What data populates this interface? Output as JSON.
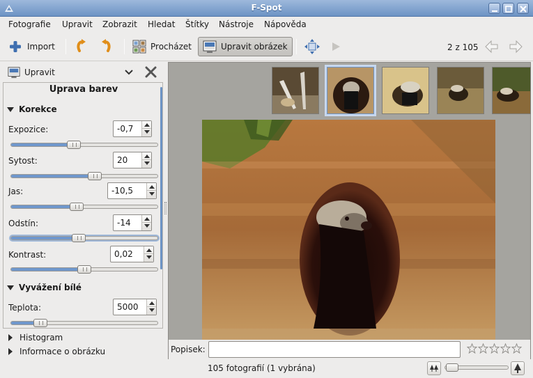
{
  "window": {
    "title": "F-Spot"
  },
  "menu": [
    "Fotografie",
    "Upravit",
    "Zobrazit",
    "Hledat",
    "Štítky",
    "Nástroje",
    "Nápověda"
  ],
  "toolbar": {
    "import_label": "Import",
    "browse_label": "Procházet",
    "edit_label": "Upravit obrázek",
    "position": "2 z 105"
  },
  "panel": {
    "selector_label": "Upravit",
    "section_title": "Uprava barev",
    "groups": {
      "correction": "Korekce",
      "white_balance": "Vyvážení bílé"
    },
    "controls": [
      {
        "label": "Expozice:",
        "value": "-0,7",
        "level": 0.42
      },
      {
        "label": "Sytost:",
        "value": "20",
        "level": 0.58
      },
      {
        "label": "Jas:",
        "value": "-10,5",
        "level": 0.44
      },
      {
        "label": "Odstín:",
        "value": "-14",
        "level": 0.46
      },
      {
        "label": "Kontrast:",
        "value": "0,02",
        "level": 0.5
      },
      {
        "label": "Teplota:",
        "value": "5000",
        "level": 0.17
      }
    ],
    "expanders": [
      "Histogram",
      "Informace o obrázku"
    ]
  },
  "viewer": {
    "caption_label": "Popisek:",
    "caption_value": "",
    "rating": 0,
    "rating_max": 5
  },
  "status": {
    "text": "105 fotografií (1 vybrána)",
    "zoom_level": 0.02
  },
  "colors": {
    "accent": "#6d93c4",
    "selection": "#c8d8ee"
  }
}
